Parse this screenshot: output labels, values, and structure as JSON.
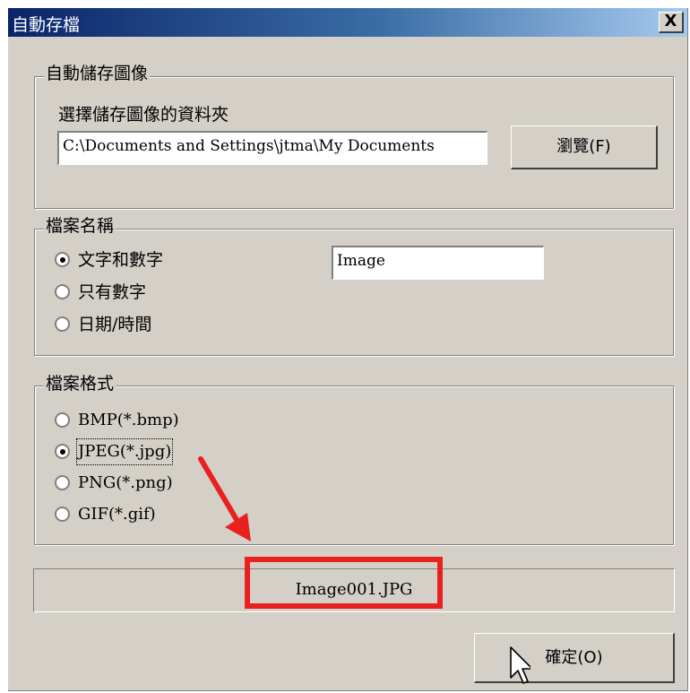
{
  "window": {
    "title": "自動存檔",
    "close_label": "X"
  },
  "auto_save": {
    "legend": "自動儲存圖像",
    "folder_label": "選擇儲存圖像的資料夾",
    "folder_path": "C:\\Documents and Settings\\jtma\\My Documents",
    "browse_label": "瀏覽(F)"
  },
  "file_name": {
    "legend": "檔案名稱",
    "options": [
      {
        "label": "文字和數字",
        "selected": true
      },
      {
        "label": "只有數字",
        "selected": false
      },
      {
        "label": "日期/時間",
        "selected": false
      }
    ],
    "prefix_value": "Image"
  },
  "file_format": {
    "legend": "檔案格式",
    "options": [
      {
        "label": "BMP(*.bmp)",
        "selected": false
      },
      {
        "label": "JPEG(*.jpg)",
        "selected": true
      },
      {
        "label": "PNG(*.png)",
        "selected": false
      },
      {
        "label": "GIF(*.gif)",
        "selected": false
      }
    ]
  },
  "preview_filename": "Image001.JPG",
  "ok_label": "確定(O)",
  "colors": {
    "titlebar_start": "#0a246a",
    "titlebar_end": "#a6caf0",
    "dialog_bg": "#d4d0c8",
    "annotation": "#e8201e"
  },
  "icons": {
    "close": "close-icon",
    "cursor": "mouse-pointer-icon",
    "arrow": "annotation-arrow-icon"
  }
}
